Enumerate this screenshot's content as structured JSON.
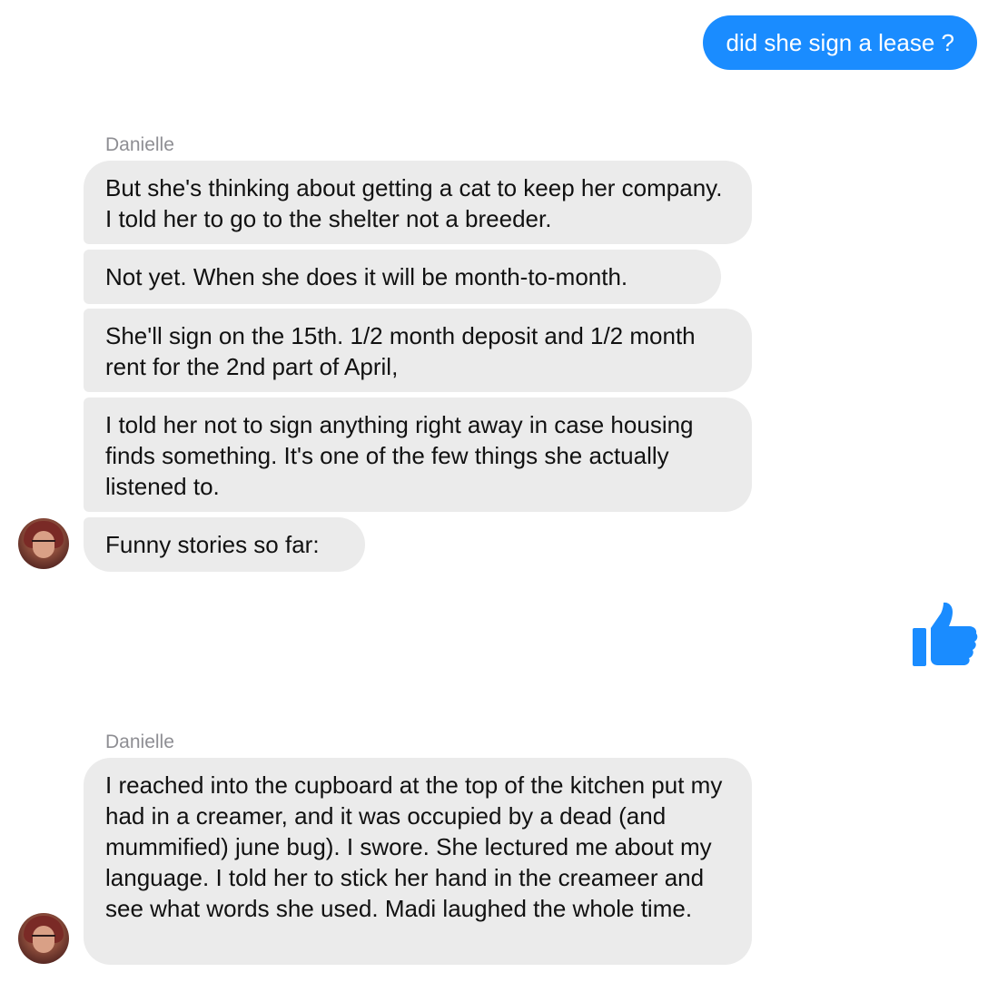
{
  "colors": {
    "outgoing_bubble": "#1a8cff",
    "incoming_bubble": "#ebebeb",
    "like_icon": "#1a8cff",
    "sender_name": "#8e8e93"
  },
  "conversation": {
    "outgoing_message": "did she sign a lease ?",
    "group1": {
      "sender": "Danielle",
      "messages": [
        "But she's thinking about getting a cat to keep her company. I told her to go to the shelter not a breeder.",
        "Not yet. When she does it will be month-to-month.",
        "She'll sign on the 15th. 1/2 month deposit and 1/2 month rent for the 2nd part of April,",
        "I told her not to sign anything right away in case housing finds something. It's one of the few things she actually listened to.",
        "Funny stories so far:"
      ]
    },
    "like": {
      "icon": "thumbs-up-icon"
    },
    "group2": {
      "sender": "Danielle",
      "messages": [
        "I reached into the cupboard at the top of the kitchen put my had in a creamer, and it was occupied by a dead (and mummified) june bug). I swore. She lectured me about my language. I told her to stick her hand in the creameer and see what words she used. Madi laughed the whole time."
      ]
    }
  }
}
